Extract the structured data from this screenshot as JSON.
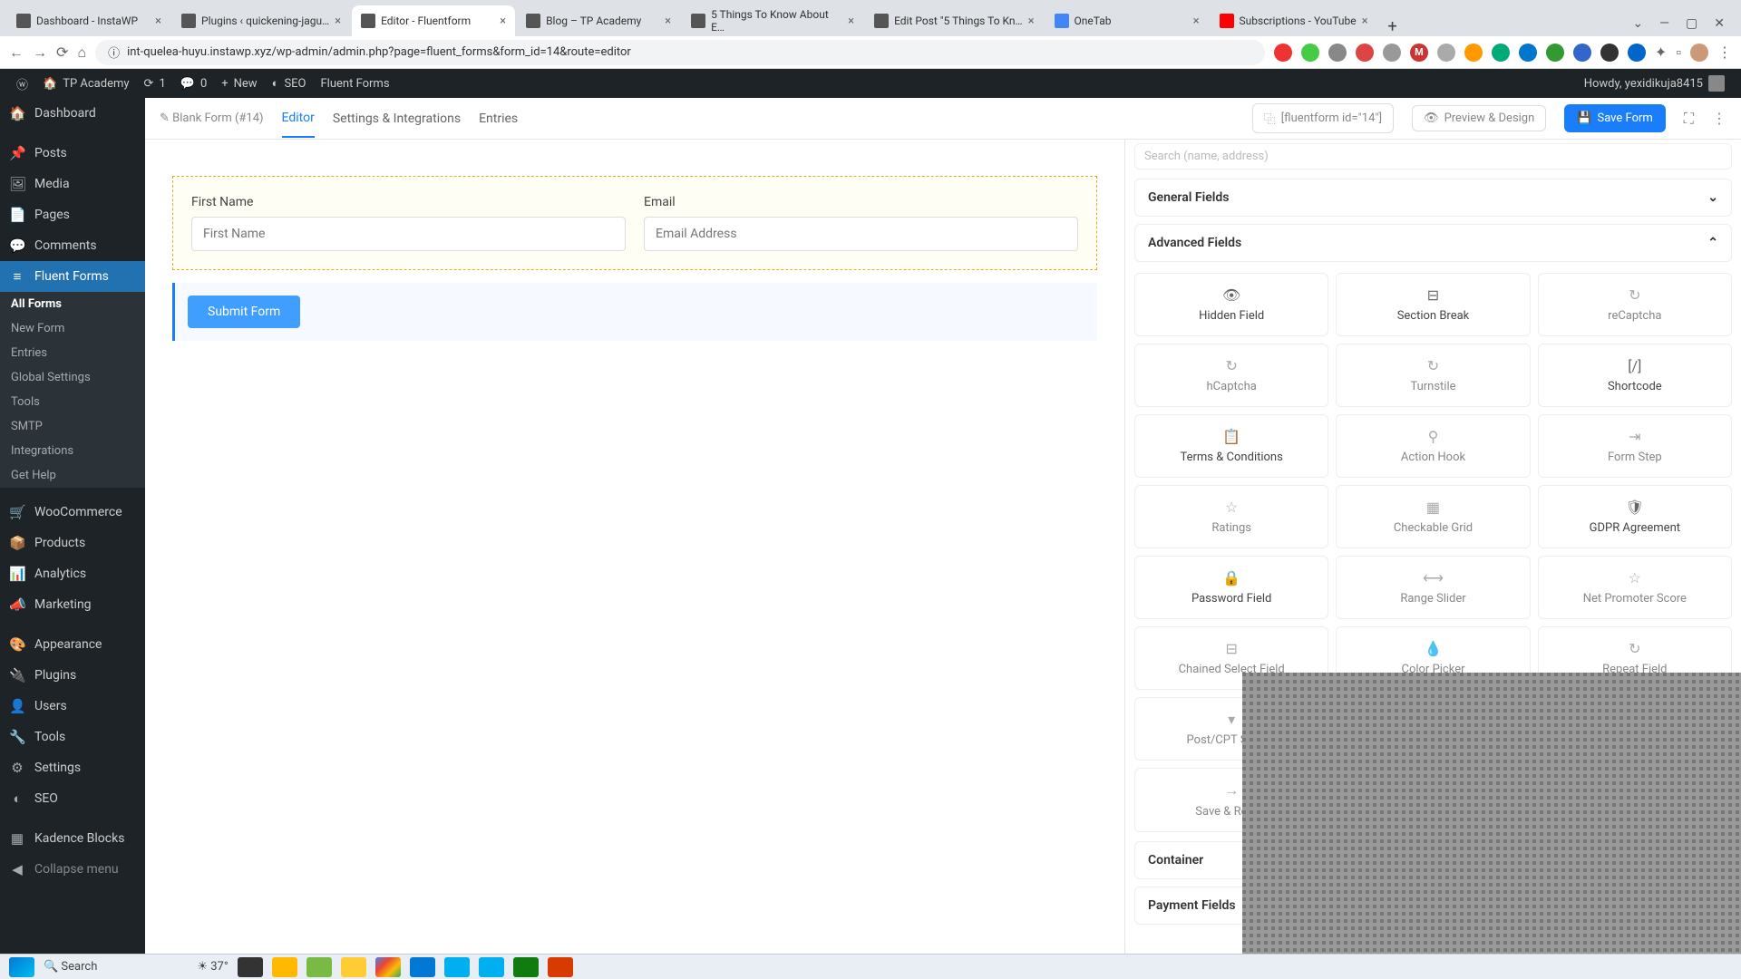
{
  "browser": {
    "tabs": [
      {
        "title": "Dashboard - InstaWP",
        "active": false
      },
      {
        "title": "Plugins ‹ quickening-jagu…",
        "active": false
      },
      {
        "title": "Editor - Fluentform",
        "active": true
      },
      {
        "title": "Blog – TP Academy",
        "active": false
      },
      {
        "title": "5 Things To Know About E…",
        "active": false
      },
      {
        "title": "Edit Post \"5 Things To Kn…",
        "active": false
      },
      {
        "title": "OneTab",
        "active": false
      },
      {
        "title": "Subscriptions - YouTube",
        "active": false
      }
    ],
    "url": "int-quelea-huyu.instawp.xyz/wp-admin/admin.php?page=fluent_forms&form_id=14&route=editor"
  },
  "adminbar": {
    "site": "TP Academy",
    "updates": "1",
    "comments": "0",
    "new": "New",
    "seo": "SEO",
    "fluent": "Fluent Forms",
    "howdy": "Howdy, yexidikuja8415"
  },
  "sidebar": {
    "items": [
      {
        "label": "Dashboard",
        "icon": "🏠"
      },
      {
        "label": "Posts",
        "icon": "📌"
      },
      {
        "label": "Media",
        "icon": "🖼"
      },
      {
        "label": "Pages",
        "icon": "📄"
      },
      {
        "label": "Comments",
        "icon": "💬"
      },
      {
        "label": "Fluent Forms",
        "icon": "≡",
        "current": true
      },
      {
        "label": "WooCommerce",
        "icon": "🛒"
      },
      {
        "label": "Products",
        "icon": "📦"
      },
      {
        "label": "Analytics",
        "icon": "📊"
      },
      {
        "label": "Marketing",
        "icon": "📣"
      },
      {
        "label": "Appearance",
        "icon": "🎨"
      },
      {
        "label": "Plugins",
        "icon": "🔌"
      },
      {
        "label": "Users",
        "icon": "👤"
      },
      {
        "label": "Tools",
        "icon": "🔧"
      },
      {
        "label": "Settings",
        "icon": "⚙"
      },
      {
        "label": "SEO",
        "icon": "◐"
      },
      {
        "label": "Kadence Blocks",
        "icon": "▦"
      }
    ],
    "submenu": [
      {
        "label": "All Forms",
        "current": true
      },
      {
        "label": "New Form"
      },
      {
        "label": "Entries"
      },
      {
        "label": "Global Settings"
      },
      {
        "label": "Tools"
      },
      {
        "label": "SMTP"
      },
      {
        "label": "Integrations"
      },
      {
        "label": "Get Help"
      }
    ],
    "collapse": "Collapse menu"
  },
  "topbar": {
    "formname": "Blank Form (#14)",
    "tabs": {
      "editor": "Editor",
      "settings": "Settings & Integrations",
      "entries": "Entries"
    },
    "shortcode": "[fluentform id=\"14\"]",
    "preview": "Preview & Design",
    "save": "Save Form"
  },
  "form": {
    "first_name_label": "First Name",
    "first_name_placeholder": "First Name",
    "email_label": "Email",
    "email_placeholder": "Email Address",
    "submit": "Submit Form"
  },
  "panel": {
    "search_placeholder": "Search (name, address)",
    "general": "General Fields",
    "advanced": "Advanced Fields",
    "container": "Container",
    "payment": "Payment Fields",
    "fields": [
      {
        "label": "Hidden Field",
        "icon": "👁",
        "enabled": true
      },
      {
        "label": "Section Break",
        "icon": "⊟",
        "enabled": true
      },
      {
        "label": "reCaptcha",
        "icon": "↻",
        "enabled": false
      },
      {
        "label": "hCaptcha",
        "icon": "↻",
        "enabled": false
      },
      {
        "label": "Turnstile",
        "icon": "↻",
        "enabled": false
      },
      {
        "label": "Shortcode",
        "icon": "[/]",
        "enabled": true
      },
      {
        "label": "Terms & Conditions",
        "icon": "📋",
        "enabled": true
      },
      {
        "label": "Action Hook",
        "icon": "⚲",
        "enabled": false
      },
      {
        "label": "Form Step",
        "icon": "⇥",
        "enabled": false
      },
      {
        "label": "Ratings",
        "icon": "☆",
        "enabled": false
      },
      {
        "label": "Checkable Grid",
        "icon": "▦",
        "enabled": false
      },
      {
        "label": "GDPR Agreement",
        "icon": "🛡",
        "enabled": true
      },
      {
        "label": "Password Field",
        "icon": "🔒",
        "enabled": true
      },
      {
        "label": "Range Slider",
        "icon": "⟷",
        "enabled": false
      },
      {
        "label": "Net Promoter Score",
        "icon": "☆",
        "enabled": false
      },
      {
        "label": "Chained Select Field",
        "icon": "⊟",
        "enabled": false
      },
      {
        "label": "Color Picker",
        "icon": "💧",
        "enabled": false
      },
      {
        "label": "Repeat Field",
        "icon": "↻",
        "enabled": false
      },
      {
        "label": "Post/CPT Selec…",
        "icon": "▾",
        "enabled": false
      },
      {
        "label": "",
        "icon": "▦",
        "enabled": false
      },
      {
        "label": "",
        "icon": "◁",
        "enabled": false
      },
      {
        "label": "Save & Resu…",
        "icon": "→",
        "enabled": false
      }
    ]
  },
  "taskbar": {
    "temp": "37°",
    "search": "Search"
  }
}
